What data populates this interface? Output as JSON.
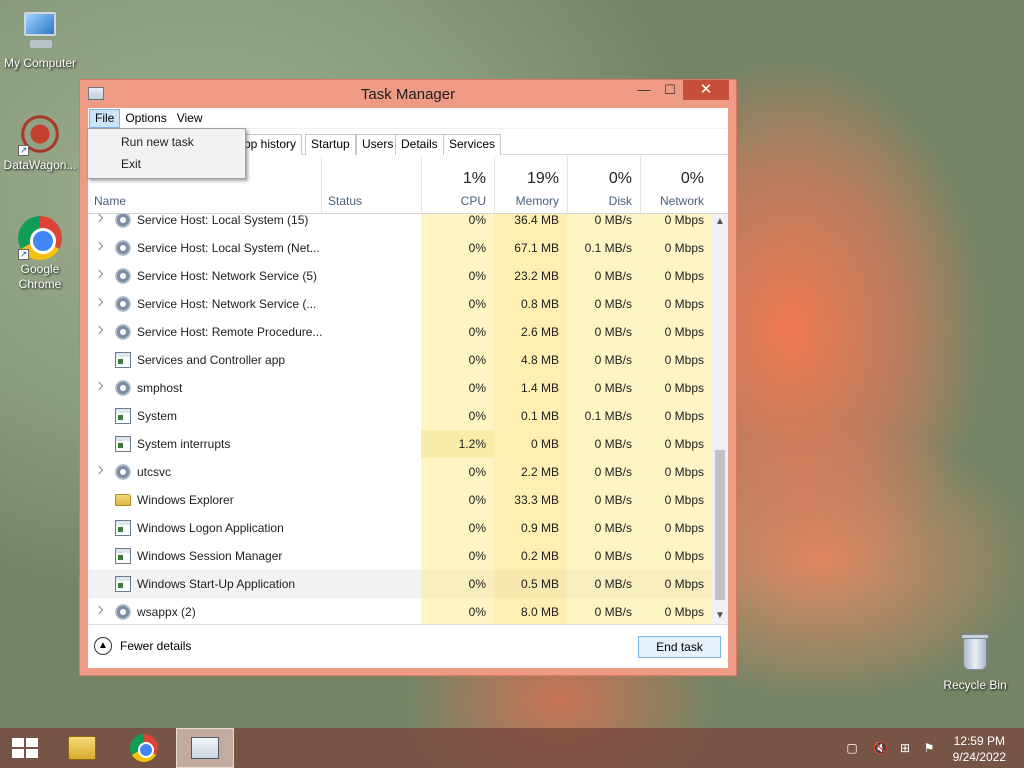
{
  "desktop": {
    "icons": [
      {
        "label": "My Computer"
      },
      {
        "label": "DataWagon..."
      },
      {
        "label": "Google Chrome"
      },
      {
        "label": "Recycle Bin"
      }
    ]
  },
  "window": {
    "title": "Task Manager",
    "controls": {
      "minimize": "—",
      "maximize": "☐",
      "close": "✕"
    },
    "menu": [
      "File",
      "Options",
      "View"
    ],
    "file_menu": [
      "Run new task",
      "Exit"
    ],
    "tabs": [
      "pp history",
      "Startup",
      "Users",
      "Details",
      "Services"
    ],
    "columns": {
      "name": "Name",
      "status": "Status",
      "cpu": {
        "pct": "1%",
        "label": "CPU"
      },
      "memory": {
        "pct": "19%",
        "label": "Memory"
      },
      "disk": {
        "pct": "0%",
        "label": "Disk"
      },
      "network": {
        "pct": "0%",
        "label": "Network"
      }
    },
    "rows": [
      {
        "name": "Service Host: Local System (15)",
        "icon": "gear-icon",
        "expandable": true,
        "cpu": "0%",
        "mem": "36.4 MB",
        "disk": "0 MB/s",
        "net": "0 Mbps"
      },
      {
        "name": "Service Host: Local System (Net...",
        "icon": "gear-icon",
        "expandable": true,
        "cpu": "0%",
        "mem": "67.1 MB",
        "disk": "0.1 MB/s",
        "net": "0 Mbps"
      },
      {
        "name": "Service Host: Network Service (5)",
        "icon": "gear-icon",
        "expandable": true,
        "cpu": "0%",
        "mem": "23.2 MB",
        "disk": "0 MB/s",
        "net": "0 Mbps"
      },
      {
        "name": "Service Host: Network Service (...",
        "icon": "gear-icon",
        "expandable": true,
        "cpu": "0%",
        "mem": "0.8 MB",
        "disk": "0 MB/s",
        "net": "0 Mbps"
      },
      {
        "name": "Service Host: Remote Procedure...",
        "icon": "gear-icon",
        "expandable": true,
        "cpu": "0%",
        "mem": "2.6 MB",
        "disk": "0 MB/s",
        "net": "0 Mbps"
      },
      {
        "name": "Services and Controller app",
        "icon": "app-icon",
        "expandable": false,
        "cpu": "0%",
        "mem": "4.8 MB",
        "disk": "0 MB/s",
        "net": "0 Mbps"
      },
      {
        "name": "smphost",
        "icon": "gear-icon",
        "expandable": true,
        "cpu": "0%",
        "mem": "1.4 MB",
        "disk": "0 MB/s",
        "net": "0 Mbps"
      },
      {
        "name": "System",
        "icon": "app-icon",
        "expandable": false,
        "cpu": "0%",
        "mem": "0.1 MB",
        "disk": "0.1 MB/s",
        "net": "0 Mbps"
      },
      {
        "name": "System interrupts",
        "icon": "app-icon",
        "expandable": false,
        "cpu": "1.2%",
        "mem": "0 MB",
        "disk": "0 MB/s",
        "net": "0 Mbps"
      },
      {
        "name": "utcsvc",
        "icon": "gear-icon",
        "expandable": true,
        "cpu": "0%",
        "mem": "2.2 MB",
        "disk": "0 MB/s",
        "net": "0 Mbps"
      },
      {
        "name": "Windows Explorer",
        "icon": "folder-icon",
        "expandable": false,
        "cpu": "0%",
        "mem": "33.3 MB",
        "disk": "0 MB/s",
        "net": "0 Mbps"
      },
      {
        "name": "Windows Logon Application",
        "icon": "app-icon",
        "expandable": false,
        "cpu": "0%",
        "mem": "0.9 MB",
        "disk": "0 MB/s",
        "net": "0 Mbps"
      },
      {
        "name": "Windows Session Manager",
        "icon": "app-icon",
        "expandable": false,
        "cpu": "0%",
        "mem": "0.2 MB",
        "disk": "0 MB/s",
        "net": "0 Mbps"
      },
      {
        "name": "Windows Start-Up Application",
        "icon": "app-icon",
        "expandable": false,
        "cpu": "0%",
        "mem": "0.5 MB",
        "disk": "0 MB/s",
        "net": "0 Mbps",
        "highlighted": true
      },
      {
        "name": "wsappx (2)",
        "icon": "gear-icon",
        "expandable": true,
        "cpu": "0%",
        "mem": "8.0 MB",
        "disk": "0 MB/s",
        "net": "0 Mbps"
      }
    ],
    "footer": {
      "fewer_details": "Fewer details",
      "end_task": "End task"
    }
  },
  "taskbar": {
    "clock_time": "12:59 PM",
    "clock_date": "9/24/2022"
  }
}
